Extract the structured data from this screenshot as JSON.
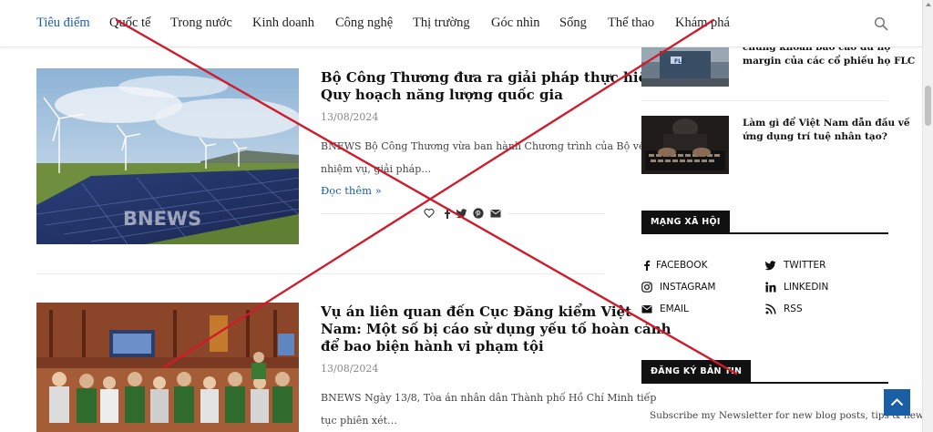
{
  "nav": {
    "items": [
      "Tiêu điểm",
      "Quốc tế",
      "Trong nước",
      "Kinh doanh",
      "Công nghệ",
      "Thị trường",
      "Góc nhìn",
      "Sống",
      "Thể thao",
      "Khám phá"
    ],
    "active_index": 0
  },
  "articles": [
    {
      "title_lines": [
        "Bộ Công Thương đưa ra giải pháp thực hiện",
        "Quy hoạch năng lượng quốc gia"
      ],
      "date": "13/08/2024",
      "excerpt_lines": [
        "BNEWS Bộ Công Thương vừa ban hành Chương trình của Bộ về",
        "nhiệm vụ, giải pháp…"
      ],
      "read_more": "Đọc thêm",
      "image_watermark": "BNEWS"
    },
    {
      "title_lines": [
        "Vụ án liên quan đến Cục Đăng kiểm Việt",
        "Nam: Một số bị cáo sử dụng yếu tố hoàn cảnh",
        "để bao biện hành vi phạm tội"
      ],
      "date": "13/08/2024",
      "excerpt_lines": [
        "BNEWS Ngày 13/8, Tòa án nhân dân Thành phố Hồ Chí Minh tiếp",
        "tục phiên xét…"
      ]
    }
  ],
  "sidebar": {
    "posts": [
      {
        "title_lines": [
          "chứng khoán báo cáo dư nợ",
          "margin của các cổ phiếu họ FLC"
        ]
      },
      {
        "title_lines": [
          "Làm gì để Việt Nam dẫn đầu về",
          "ứng dụng trí tuệ nhân tạo?"
        ]
      }
    ],
    "social_heading": "MẠNG XÃ HỘI",
    "social": [
      {
        "label": "FACEBOOK",
        "icon": "facebook-icon"
      },
      {
        "label": "TWITTER",
        "icon": "twitter-icon"
      },
      {
        "label": "INSTAGRAM",
        "icon": "instagram-icon"
      },
      {
        "label": "LINKEDIN",
        "icon": "linkedin-icon"
      },
      {
        "label": "EMAIL",
        "icon": "email-icon"
      },
      {
        "label": "RSS",
        "icon": "rss-icon"
      }
    ],
    "newsletter_heading": "ĐĂNG KÝ BẢN TIN",
    "newsletter_text": "Subscribe my Newsletter for new blog posts, tips & new"
  },
  "colors": {
    "accent": "#1a5fa5",
    "overlay_cross": "#d11a2a",
    "heading_bg": "#111111"
  }
}
